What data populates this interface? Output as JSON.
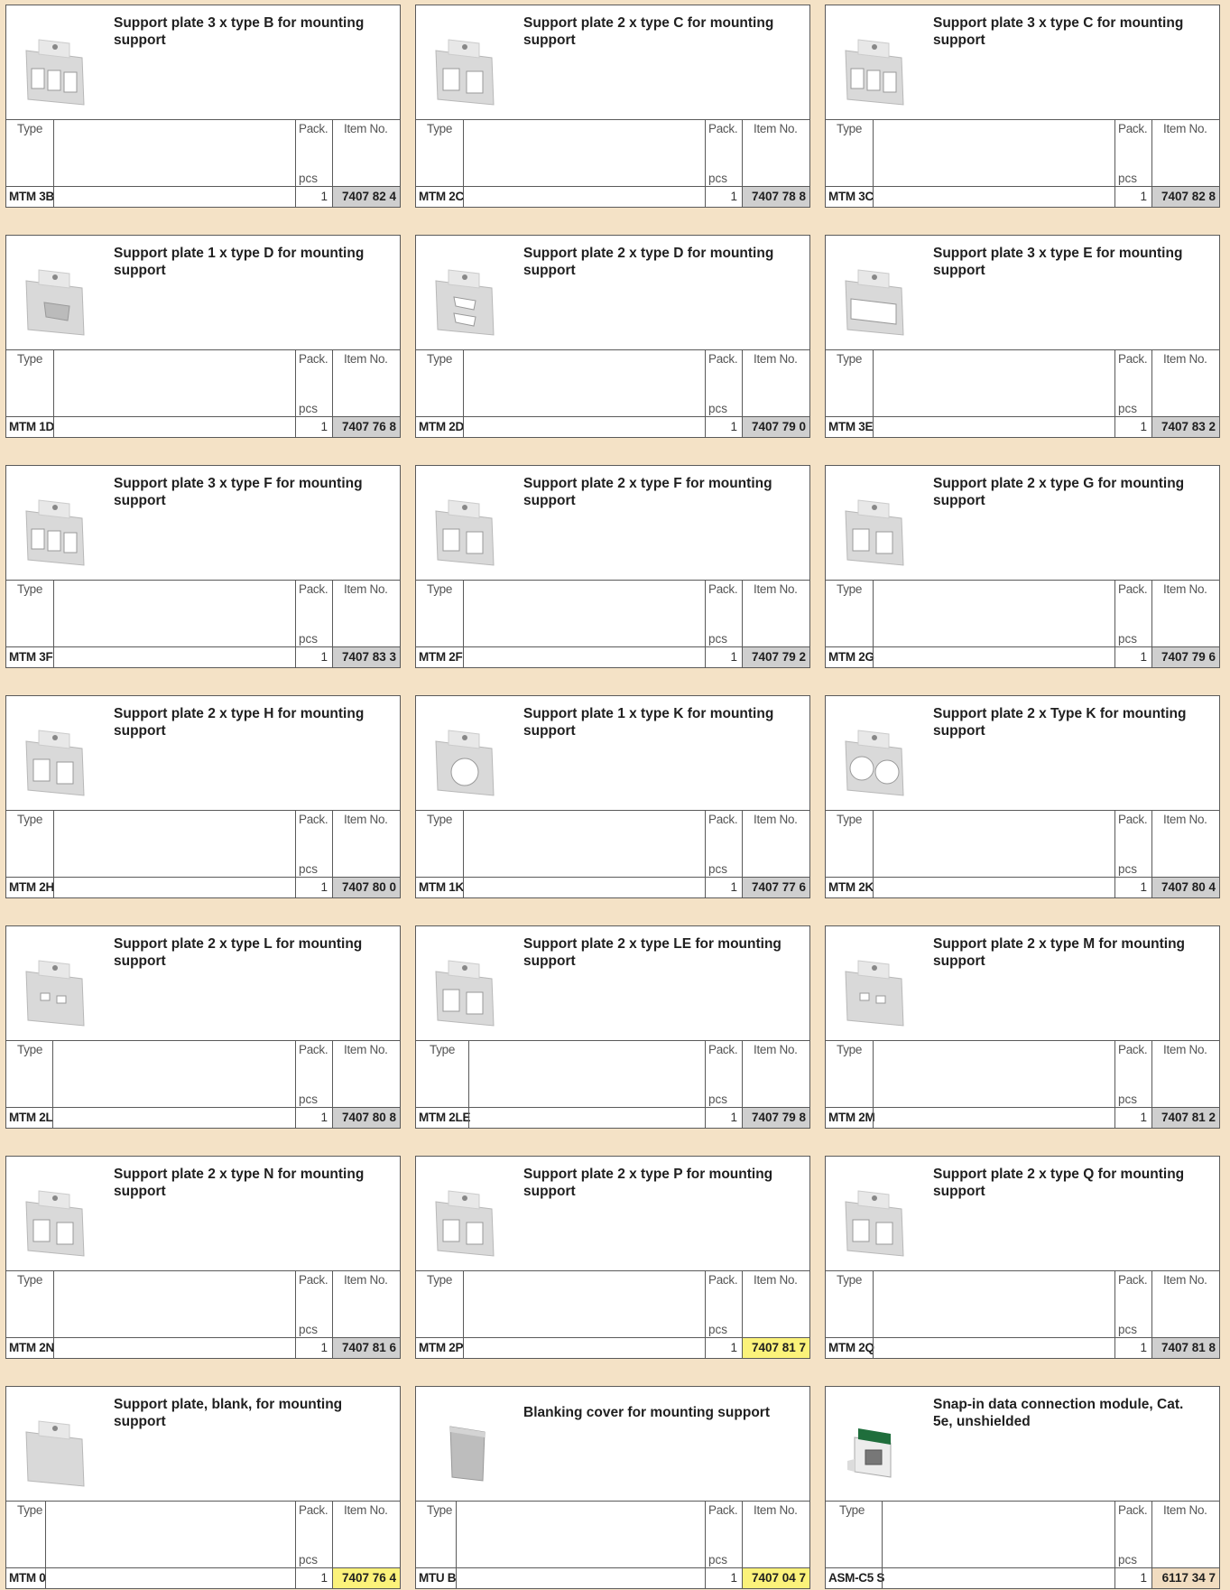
{
  "labels": {
    "type": "Type",
    "pack": "Pack.",
    "item_no": "Item No.",
    "pcs": "pcs"
  },
  "colors": {
    "item_grey": "#cfcfcf",
    "item_yellow": "#fbf27a",
    "item_tan": "#f1dcc0",
    "background": "#f4e2c6"
  },
  "products": [
    {
      "title": "Support plate 3 x type B for mounting support",
      "type": "MTM 3B",
      "pack": "1",
      "item_no": "7407 82 4",
      "highlight": "grey",
      "icon": "plate-3-rect-icon"
    },
    {
      "title": "Support plate 2 x type C for mounting support",
      "type": "MTM 2C",
      "pack": "1",
      "item_no": "7407 78 8",
      "highlight": "grey",
      "icon": "plate-2-rect-icon"
    },
    {
      "title": "Support plate 3 x type C for mounting support",
      "type": "MTM 3C",
      "pack": "1",
      "item_no": "7407 82 8",
      "highlight": "grey",
      "icon": "plate-3-rect-icon"
    },
    {
      "title": "Support plate 1 x type D for mounting support",
      "type": "MTM 1D",
      "pack": "1",
      "item_no": "7407 76 8",
      "highlight": "grey",
      "icon": "plate-1-dsub-icon"
    },
    {
      "title": "Support plate 2 x type D for mounting support",
      "type": "MTM 2D",
      "pack": "1",
      "item_no": "7407 79 0",
      "highlight": "grey",
      "icon": "plate-2-dsub-icon"
    },
    {
      "title": "Support plate 3 x type E for mounting support",
      "type": "MTM 3E",
      "pack": "1",
      "item_no": "7407 83 2",
      "highlight": "grey",
      "icon": "plate-wide-icon"
    },
    {
      "title": "Support plate 3 x type F for mounting support",
      "type": "MTM 3F",
      "pack": "1",
      "item_no": "7407 83 3",
      "highlight": "grey",
      "icon": "plate-3-rect-icon"
    },
    {
      "title": "Support plate 2 x type F for mounting support",
      "type": "MTM 2F",
      "pack": "1",
      "item_no": "7407 79 2",
      "highlight": "grey",
      "icon": "plate-2-rect-icon"
    },
    {
      "title": "Support plate 2 x type G for mounting support",
      "type": "MTM 2G",
      "pack": "1",
      "item_no": "7407 79 6",
      "highlight": "grey",
      "icon": "plate-2-rect-icon"
    },
    {
      "title": "Support plate 2 x type H for mounting support",
      "type": "MTM 2H",
      "pack": "1",
      "item_no": "7407 80 0",
      "highlight": "grey",
      "icon": "plate-2-rect-icon"
    },
    {
      "title": "Support plate 1 x type K for mounting support",
      "type": "MTM 1K",
      "pack": "1",
      "item_no": "7407 77 6",
      "highlight": "grey",
      "icon": "plate-1-round-icon"
    },
    {
      "title": "Support plate 2 x Type K for mounting support",
      "type": "MTM 2K",
      "pack": "1",
      "item_no": "7407 80 4",
      "highlight": "grey",
      "icon": "plate-2-round-icon"
    },
    {
      "title": "Support plate 2 x type L for mounting support",
      "type": "MTM 2L",
      "pack": "1",
      "item_no": "7407 80 8",
      "highlight": "grey",
      "icon": "plate-2-small-icon"
    },
    {
      "title": "Support plate 2 x type LE for mounting support",
      "type": "MTM 2LE",
      "pack": "1",
      "item_no": "7407 79 8",
      "highlight": "grey",
      "icon": "plate-2-rect-icon"
    },
    {
      "title": "Support plate 2 x type M for mounting support",
      "type": "MTM 2M",
      "pack": "1",
      "item_no": "7407 81 2",
      "highlight": "grey",
      "icon": "plate-2-small-icon"
    },
    {
      "title": "Support plate 2 x type N for mounting support",
      "type": "MTM 2N",
      "pack": "1",
      "item_no": "7407 81 6",
      "highlight": "grey",
      "icon": "plate-2-rect-icon"
    },
    {
      "title": "Support plate 2 x type P for mounting support",
      "type": "MTM 2P",
      "pack": "1",
      "item_no": "7407 81 7",
      "highlight": "yellow",
      "icon": "plate-2-rect-icon"
    },
    {
      "title": "Support plate 2 x type Q for mounting support",
      "type": "MTM 2Q",
      "pack": "1",
      "item_no": "7407 81 8",
      "highlight": "grey",
      "icon": "plate-2-rect-icon"
    },
    {
      "title": "Support plate, blank, for mounting support",
      "type": "MTM 0",
      "pack": "1",
      "item_no": "7407 76 4",
      "highlight": "yellow",
      "icon": "plate-blank-icon"
    },
    {
      "title": "Blanking cover for mounting support",
      "type": "MTU B",
      "pack": "1",
      "item_no": "7407 04 7",
      "highlight": "yellow",
      "icon": "blanking-cover-icon"
    },
    {
      "title": "Snap-in data connection module, Cat. 5e, unshielded",
      "type": "ASM-C5 S",
      "pack": "1",
      "item_no": "6117 34 7",
      "highlight": "tan",
      "icon": "rj45-module-icon"
    }
  ]
}
